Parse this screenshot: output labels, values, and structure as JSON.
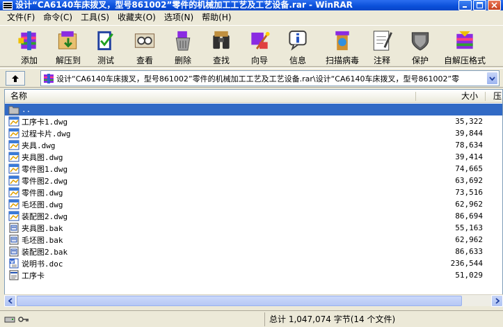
{
  "window": {
    "title": "设计“CA6140车床拨叉，型号861002”零件的机械加工工艺及工艺设备.rar - WinRAR"
  },
  "menu": [
    {
      "label": "文件(F)"
    },
    {
      "label": "命令(C)"
    },
    {
      "label": "工具(S)"
    },
    {
      "label": "收藏夹(O)"
    },
    {
      "label": "选项(N)"
    },
    {
      "label": "帮助(H)"
    }
  ],
  "toolbar": [
    {
      "label": "添加",
      "icon": "add-icon"
    },
    {
      "label": "解压到",
      "icon": "extract-icon"
    },
    {
      "label": "测试",
      "icon": "test-icon"
    },
    {
      "label": "查看",
      "icon": "view-icon"
    },
    {
      "label": "删除",
      "icon": "delete-icon"
    },
    {
      "label": "查找",
      "icon": "find-icon"
    },
    {
      "label": "向导",
      "icon": "wizard-icon"
    },
    {
      "label": "信息",
      "icon": "info-icon"
    },
    {
      "label": "扫描病毒",
      "icon": "virus-scan-icon"
    },
    {
      "label": "注释",
      "icon": "comment-icon"
    },
    {
      "label": "保护",
      "icon": "protect-icon"
    },
    {
      "label": "自解压格式",
      "icon": "sfx-icon"
    }
  ],
  "address": {
    "path": "设计“CA6140车床拨叉，型号861002”零件的机械加工工艺及工艺设备.rar\\设计“CA6140车床拨叉，型号861002”零"
  },
  "columns": {
    "name": "名称",
    "size": "大小",
    "packed": "压"
  },
  "files": [
    {
      "name": "..",
      "size": "",
      "type": "folder-up",
      "selected": true
    },
    {
      "name": "工序卡1.dwg",
      "size": "35,322",
      "type": "dwg"
    },
    {
      "name": "过程卡片.dwg",
      "size": "39,844",
      "type": "dwg"
    },
    {
      "name": "夹具.dwg",
      "size": "78,634",
      "type": "dwg"
    },
    {
      "name": "夹具图.dwg",
      "size": "39,414",
      "type": "dwg"
    },
    {
      "name": "零件图1.dwg",
      "size": "74,665",
      "type": "dwg"
    },
    {
      "name": "零件图2.dwg",
      "size": "63,692",
      "type": "dwg"
    },
    {
      "name": "零件图.dwg",
      "size": "73,516",
      "type": "dwg"
    },
    {
      "name": "毛坯图.dwg",
      "size": "62,962",
      "type": "dwg"
    },
    {
      "name": "装配图2.dwg",
      "size": "86,694",
      "type": "dwg"
    },
    {
      "name": "夹具图.bak",
      "size": "55,163",
      "type": "bak"
    },
    {
      "name": "毛坯图.bak",
      "size": "62,962",
      "type": "bak"
    },
    {
      "name": "装配图2.bak",
      "size": "86,633",
      "type": "bak"
    },
    {
      "name": "说明书.doc",
      "size": "236,544",
      "type": "doc"
    },
    {
      "name": "工序卡",
      "size": "51,029",
      "type": "file"
    }
  ],
  "status": {
    "summary": "总计 1,047,074 字节(14 个文件)"
  }
}
